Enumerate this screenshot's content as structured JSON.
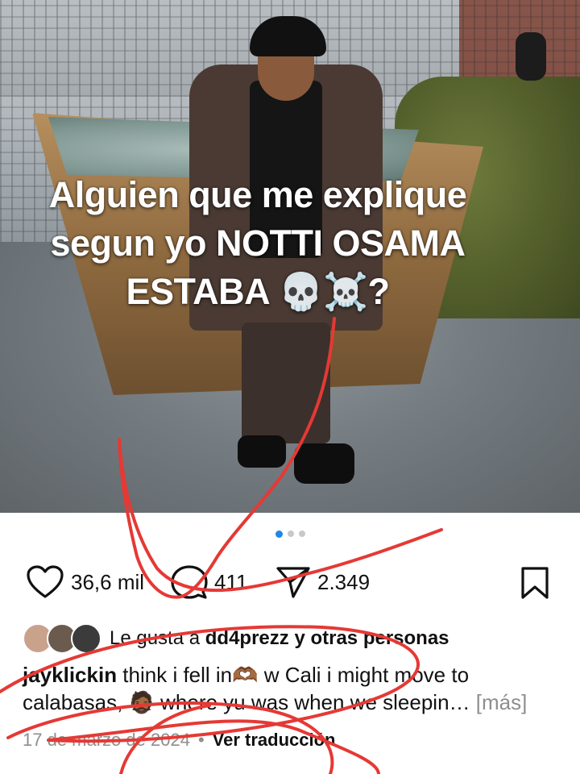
{
  "post": {
    "overlay_text": [
      "Alguien que me explique",
      "segun yo NOTTI OSAMA",
      "ESTABA 💀☠️?"
    ],
    "pager": {
      "count": 3,
      "active": 0
    }
  },
  "actions": {
    "like_count": "36,6 mil",
    "comment_count": "411",
    "share_count": "2.349",
    "icons": [
      "heart-icon",
      "comment-icon",
      "send-icon",
      "bookmark-icon"
    ]
  },
  "likes": {
    "prefix": "Le gusta a ",
    "user": "dd4prezz",
    "suffix": " y otras personas"
  },
  "description": {
    "username": "jayklickin",
    "text": " think i fell in🫶🏾 w Cali i might move to calabasas, 🧔🏾 where yu was when we sleepin… ",
    "more": "[más]"
  },
  "meta": {
    "date": "17 de marzo de 2024",
    "separator": "•",
    "translate": "Ver traducción"
  },
  "colors": {
    "accent_blue": "#1e88e5",
    "annotation_red": "#e53935"
  }
}
